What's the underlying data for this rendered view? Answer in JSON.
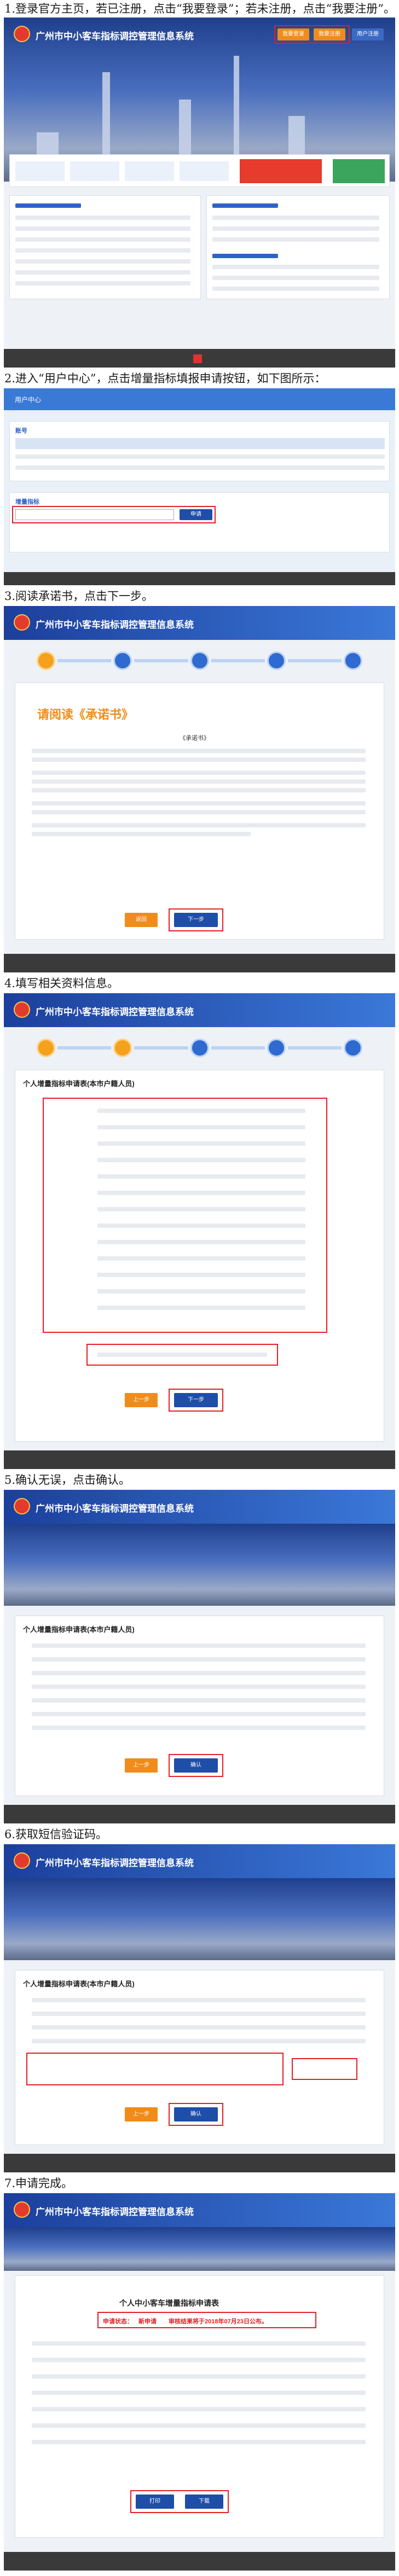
{
  "steps": [
    {
      "caption": "1.登录官方主页，若已注册，点击“我要登录”；若未注册，点击“我要注册”。"
    },
    {
      "caption": "2.进入“用户中心”，点击增量指标填报申请按钮，如下图所示："
    },
    {
      "caption": "3.阅读承诺书，点击下一步。"
    },
    {
      "caption": "4.填写相关资料信息。"
    },
    {
      "caption": "5.确认无误，点击确认。"
    },
    {
      "caption": "6.获取短信验证码。"
    },
    {
      "caption": "7.申请完成。"
    }
  ],
  "site": {
    "title": "广州市中小客车指标调控管理信息系统",
    "login_label": "我要登录",
    "register_label": "我要注册",
    "help_label": "用户注册",
    "user_center": "用户中心",
    "account_section": "账号",
    "incentive_section": "增量指标",
    "apply_label": "申请",
    "promise_title": "请阅读《承诺书》",
    "promise_heading": "《承诺书》",
    "next_label": "下一步",
    "prev_label": "上一步",
    "back_label": "返回",
    "confirm_label": "确认",
    "form_title": "个人增量指标申请表(本市户籍人员)",
    "result_title": "个人中小客车增量指标申请表",
    "result_sub": "申请状态：",
    "result_status": "新申请",
    "result_notice": "审核结果将于2018年07月23日公布。",
    "print_label": "打印",
    "download_label": "下载"
  },
  "icons": {
    "logo": "city-emblem-icon",
    "step": "step-circle-icon"
  },
  "colors": {
    "header_blue": "#2d62c8",
    "accent_orange": "#f08c1a",
    "highlight_red": "#e31e24",
    "button_blue": "#1e4ea8"
  }
}
